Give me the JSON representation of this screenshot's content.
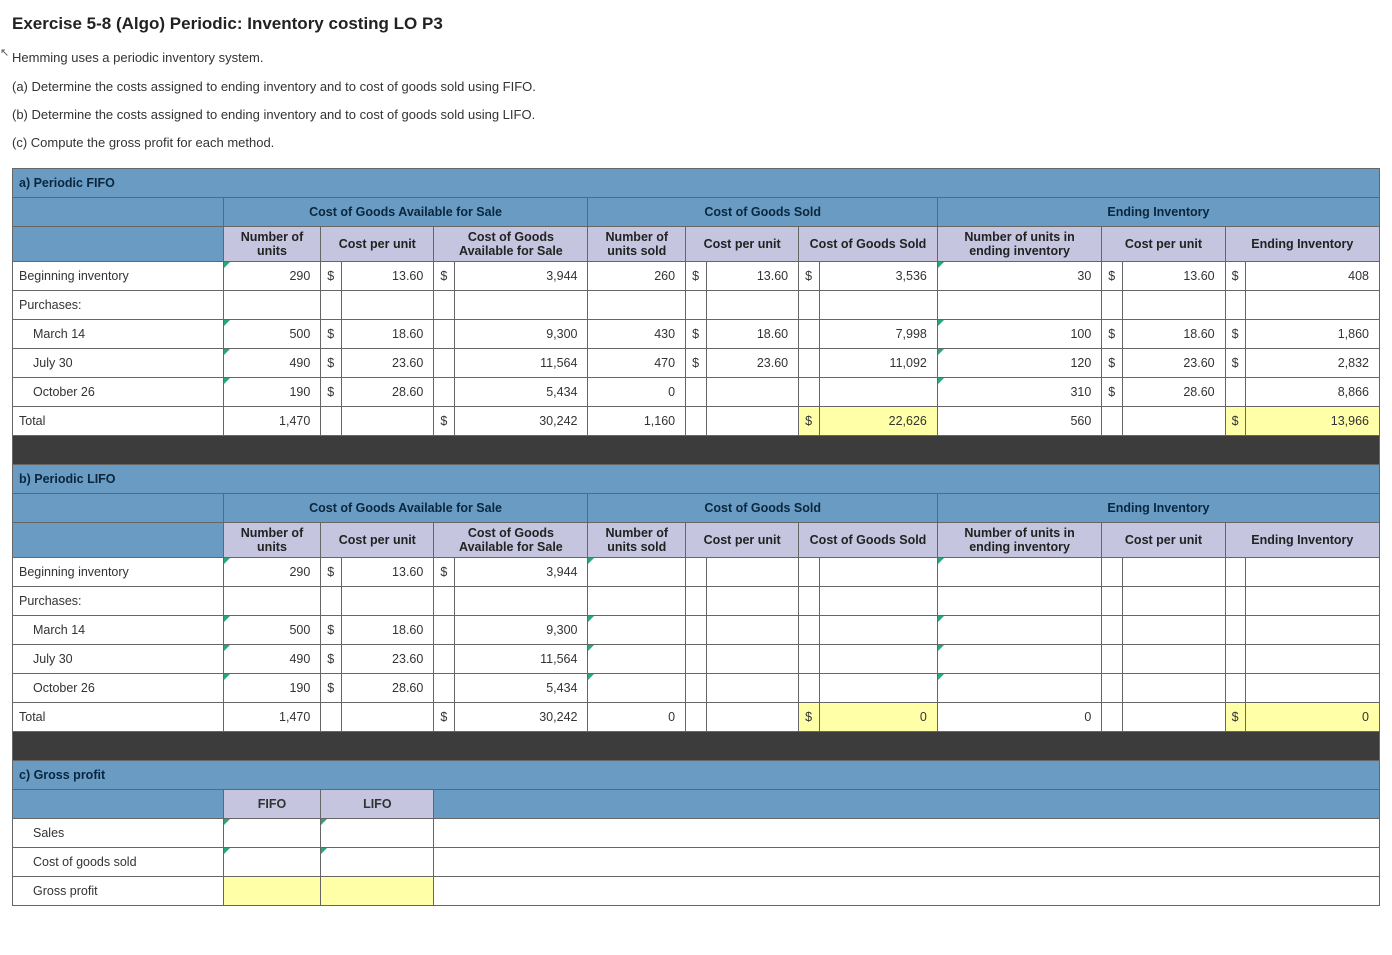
{
  "title": "Exercise 5-8 (Algo) Periodic: Inventory costing LO P3",
  "intro_line": "Hemming uses a periodic inventory system.",
  "questions": {
    "a": "(a) Determine the costs assigned to ending inventory and to cost of goods sold using FIFO.",
    "b": "(b) Determine the costs assigned to ending inventory and to cost of goods sold using LIFO.",
    "c": "(c) Compute the gross profit for each method."
  },
  "sections": {
    "a_title": "a) Periodic FIFO",
    "b_title": "b) Periodic LIFO",
    "c_title": "c) Gross profit"
  },
  "group_headers": {
    "g1": "Cost of Goods Available for Sale",
    "g2": "Cost of Goods Sold",
    "g3": "Ending Inventory"
  },
  "sub_headers": {
    "h1": "Number of units",
    "h2": "Cost per unit",
    "h3": "Cost of Goods Available for Sale",
    "h4": "Number of units sold",
    "h5": "Cost per unit",
    "h6": "Cost of Goods Sold",
    "h7": "Number of units in ending inventory",
    "h8": "Cost per unit",
    "h9": "Ending Inventory"
  },
  "row_labels": {
    "begin": "Beginning inventory",
    "purch": "Purchases:",
    "m14": "March 14",
    "j30": "July 30",
    "o26": "October 26",
    "total": "Total"
  },
  "fifo": {
    "begin": {
      "n1": "290",
      "c1": "$",
      "v1": "13.60",
      "c2": "$",
      "v2": "3,944",
      "n2": "260",
      "c3": "$",
      "v3": "13.60",
      "c4": "$",
      "v4": "3,536",
      "n3": "30",
      "c5": "$",
      "v5": "13.60",
      "c6": "$",
      "v6": "408"
    },
    "m14": {
      "n1": "500",
      "c1": "$",
      "v1": "18.60",
      "c2": "",
      "v2": "9,300",
      "n2": "430",
      "c3": "$",
      "v3": "18.60",
      "c4": "",
      "v4": "7,998",
      "n3": "100",
      "c5": "$",
      "v5": "18.60",
      "c6": "$",
      "v6": "1,860"
    },
    "j30": {
      "n1": "490",
      "c1": "$",
      "v1": "23.60",
      "c2": "",
      "v2": "11,564",
      "n2": "470",
      "c3": "$",
      "v3": "23.60",
      "c4": "",
      "v4": "11,092",
      "n3": "120",
      "c5": "$",
      "v5": "23.60",
      "c6": "$",
      "v6": "2,832"
    },
    "o26": {
      "n1": "190",
      "c1": "$",
      "v1": "28.60",
      "c2": "",
      "v2": "5,434",
      "n2": "0",
      "c3": "",
      "v3": "",
      "c4": "",
      "v4": "",
      "n3": "310",
      "c5": "$",
      "v5": "28.60",
      "c6": "",
      "v6": "8,866"
    },
    "total": {
      "n1": "1,470",
      "c2": "$",
      "v2": "30,242",
      "n2": "1,160",
      "c4": "$",
      "v4": "22,626",
      "n3": "560",
      "c6": "$",
      "v6": "13,966"
    }
  },
  "lifo": {
    "begin": {
      "n1": "290",
      "c1": "$",
      "v1": "13.60",
      "c2": "$",
      "v2": "3,944"
    },
    "m14": {
      "n1": "500",
      "c1": "$",
      "v1": "18.60",
      "c2": "",
      "v2": "9,300"
    },
    "j30": {
      "n1": "490",
      "c1": "$",
      "v1": "23.60",
      "c2": "",
      "v2": "11,564"
    },
    "o26": {
      "n1": "190",
      "c1": "$",
      "v1": "28.60",
      "c2": "",
      "v2": "5,434"
    },
    "total": {
      "n1": "1,470",
      "c2": "$",
      "v2": "30,242",
      "n2": "0",
      "c4": "$",
      "v4": "0",
      "n3": "0",
      "c6": "$",
      "v6": "0"
    }
  },
  "gp": {
    "head_fifo": "FIFO",
    "head_lifo": "LIFO",
    "row1": "Sales",
    "row2": "Cost of goods sold",
    "row3": "Gross profit"
  }
}
